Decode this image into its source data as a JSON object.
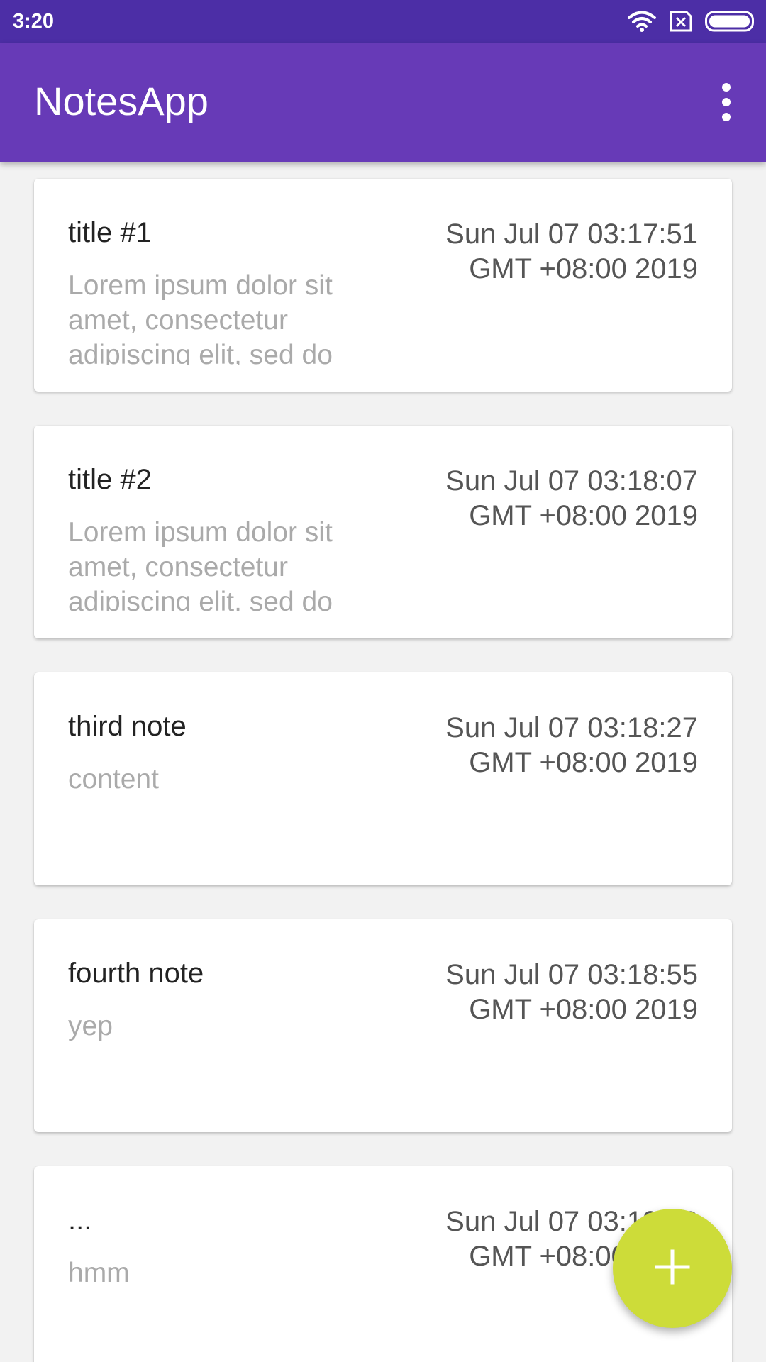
{
  "status_bar": {
    "time": "3:20"
  },
  "app_bar": {
    "title": "NotesApp"
  },
  "notes": [
    {
      "title": "title #1",
      "content": "Lorem ipsum dolor sit amet, consectetur adipiscing elit, sed do",
      "date": "Sun Jul 07 03:17:51 GMT +08:00 2019"
    },
    {
      "title": "title #2",
      "content": "Lorem ipsum dolor sit amet, consectetur adipiscing elit, sed do",
      "date": "Sun Jul 07 03:18:07 GMT +08:00 2019"
    },
    {
      "title": "third note",
      "content": "content",
      "date": "Sun Jul 07 03:18:27 GMT +08:00 2019"
    },
    {
      "title": "fourth note",
      "content": "yep",
      "date": "Sun Jul 07 03:18:55 GMT +08:00 2019"
    },
    {
      "title": "...",
      "content": "hmm",
      "date": "Sun Jul 07 03:19:18 GMT +08:00 2019"
    }
  ],
  "colors": {
    "status_bar": "#4c2ea6",
    "app_bar": "#673ab7",
    "fab": "#cddc39"
  },
  "icons": {
    "wifi": "wifi-icon",
    "sim": "no-sim-icon",
    "battery": "battery-icon",
    "overflow": "more-vert-icon",
    "fab": "add-icon"
  }
}
